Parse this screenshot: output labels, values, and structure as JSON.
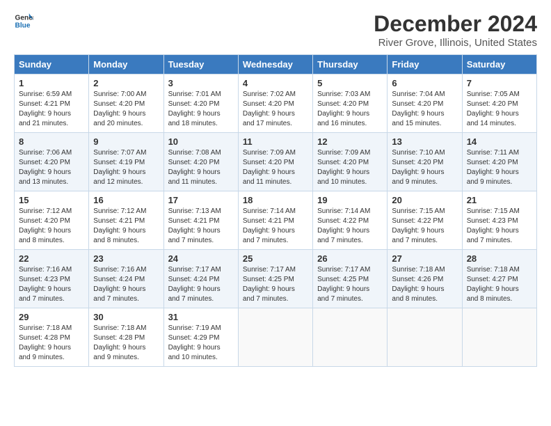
{
  "logo": {
    "line1": "General",
    "line2": "Blue"
  },
  "title": "December 2024",
  "subtitle": "River Grove, Illinois, United States",
  "days_of_week": [
    "Sunday",
    "Monday",
    "Tuesday",
    "Wednesday",
    "Thursday",
    "Friday",
    "Saturday"
  ],
  "weeks": [
    [
      {
        "day": "1",
        "sunrise": "6:59 AM",
        "sunset": "4:21 PM",
        "daylight": "9 hours and 21 minutes."
      },
      {
        "day": "2",
        "sunrise": "7:00 AM",
        "sunset": "4:20 PM",
        "daylight": "9 hours and 20 minutes."
      },
      {
        "day": "3",
        "sunrise": "7:01 AM",
        "sunset": "4:20 PM",
        "daylight": "9 hours and 18 minutes."
      },
      {
        "day": "4",
        "sunrise": "7:02 AM",
        "sunset": "4:20 PM",
        "daylight": "9 hours and 17 minutes."
      },
      {
        "day": "5",
        "sunrise": "7:03 AM",
        "sunset": "4:20 PM",
        "daylight": "9 hours and 16 minutes."
      },
      {
        "day": "6",
        "sunrise": "7:04 AM",
        "sunset": "4:20 PM",
        "daylight": "9 hours and 15 minutes."
      },
      {
        "day": "7",
        "sunrise": "7:05 AM",
        "sunset": "4:20 PM",
        "daylight": "9 hours and 14 minutes."
      }
    ],
    [
      {
        "day": "8",
        "sunrise": "7:06 AM",
        "sunset": "4:20 PM",
        "daylight": "9 hours and 13 minutes."
      },
      {
        "day": "9",
        "sunrise": "7:07 AM",
        "sunset": "4:19 PM",
        "daylight": "9 hours and 12 minutes."
      },
      {
        "day": "10",
        "sunrise": "7:08 AM",
        "sunset": "4:20 PM",
        "daylight": "9 hours and 11 minutes."
      },
      {
        "day": "11",
        "sunrise": "7:09 AM",
        "sunset": "4:20 PM",
        "daylight": "9 hours and 11 minutes."
      },
      {
        "day": "12",
        "sunrise": "7:09 AM",
        "sunset": "4:20 PM",
        "daylight": "9 hours and 10 minutes."
      },
      {
        "day": "13",
        "sunrise": "7:10 AM",
        "sunset": "4:20 PM",
        "daylight": "9 hours and 9 minutes."
      },
      {
        "day": "14",
        "sunrise": "7:11 AM",
        "sunset": "4:20 PM",
        "daylight": "9 hours and 9 minutes."
      }
    ],
    [
      {
        "day": "15",
        "sunrise": "7:12 AM",
        "sunset": "4:20 PM",
        "daylight": "9 hours and 8 minutes."
      },
      {
        "day": "16",
        "sunrise": "7:12 AM",
        "sunset": "4:21 PM",
        "daylight": "9 hours and 8 minutes."
      },
      {
        "day": "17",
        "sunrise": "7:13 AM",
        "sunset": "4:21 PM",
        "daylight": "9 hours and 7 minutes."
      },
      {
        "day": "18",
        "sunrise": "7:14 AM",
        "sunset": "4:21 PM",
        "daylight": "9 hours and 7 minutes."
      },
      {
        "day": "19",
        "sunrise": "7:14 AM",
        "sunset": "4:22 PM",
        "daylight": "9 hours and 7 minutes."
      },
      {
        "day": "20",
        "sunrise": "7:15 AM",
        "sunset": "4:22 PM",
        "daylight": "9 hours and 7 minutes."
      },
      {
        "day": "21",
        "sunrise": "7:15 AM",
        "sunset": "4:23 PM",
        "daylight": "9 hours and 7 minutes."
      }
    ],
    [
      {
        "day": "22",
        "sunrise": "7:16 AM",
        "sunset": "4:23 PM",
        "daylight": "9 hours and 7 minutes."
      },
      {
        "day": "23",
        "sunrise": "7:16 AM",
        "sunset": "4:24 PM",
        "daylight": "9 hours and 7 minutes."
      },
      {
        "day": "24",
        "sunrise": "7:17 AM",
        "sunset": "4:24 PM",
        "daylight": "9 hours and 7 minutes."
      },
      {
        "day": "25",
        "sunrise": "7:17 AM",
        "sunset": "4:25 PM",
        "daylight": "9 hours and 7 minutes."
      },
      {
        "day": "26",
        "sunrise": "7:17 AM",
        "sunset": "4:25 PM",
        "daylight": "9 hours and 7 minutes."
      },
      {
        "day": "27",
        "sunrise": "7:18 AM",
        "sunset": "4:26 PM",
        "daylight": "9 hours and 8 minutes."
      },
      {
        "day": "28",
        "sunrise": "7:18 AM",
        "sunset": "4:27 PM",
        "daylight": "9 hours and 8 minutes."
      }
    ],
    [
      {
        "day": "29",
        "sunrise": "7:18 AM",
        "sunset": "4:28 PM",
        "daylight": "9 hours and 9 minutes."
      },
      {
        "day": "30",
        "sunrise": "7:18 AM",
        "sunset": "4:28 PM",
        "daylight": "9 hours and 9 minutes."
      },
      {
        "day": "31",
        "sunrise": "7:19 AM",
        "sunset": "4:29 PM",
        "daylight": "9 hours and 10 minutes."
      },
      null,
      null,
      null,
      null
    ]
  ]
}
